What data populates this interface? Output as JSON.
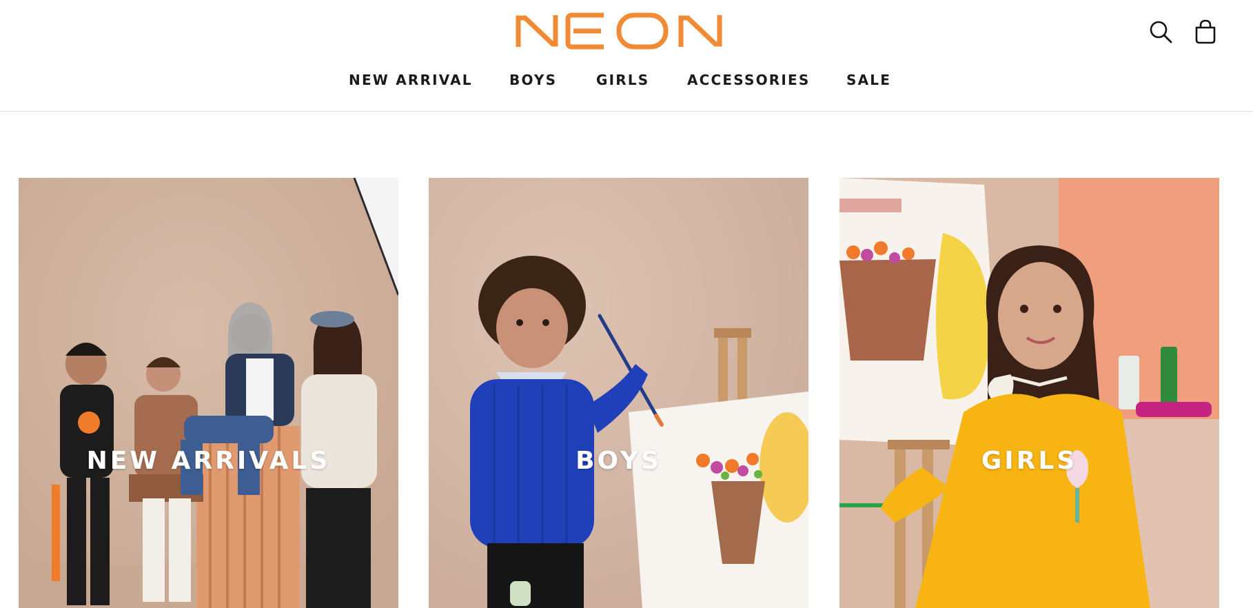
{
  "brand": {
    "name": "NEON",
    "color": "#F08A34"
  },
  "nav": {
    "items": [
      {
        "label": "NEW ARRIVAL"
      },
      {
        "label": "BOYS"
      },
      {
        "label": "GIRLS"
      },
      {
        "label": "ACCESSORIES"
      },
      {
        "label": "SALE"
      }
    ]
  },
  "header_icons": {
    "search": "search-icon",
    "cart": "shopping-bag-icon"
  },
  "categories": [
    {
      "label": "NEW ARRIVALS"
    },
    {
      "label": "BOYS"
    },
    {
      "label": "GIRLS"
    }
  ]
}
